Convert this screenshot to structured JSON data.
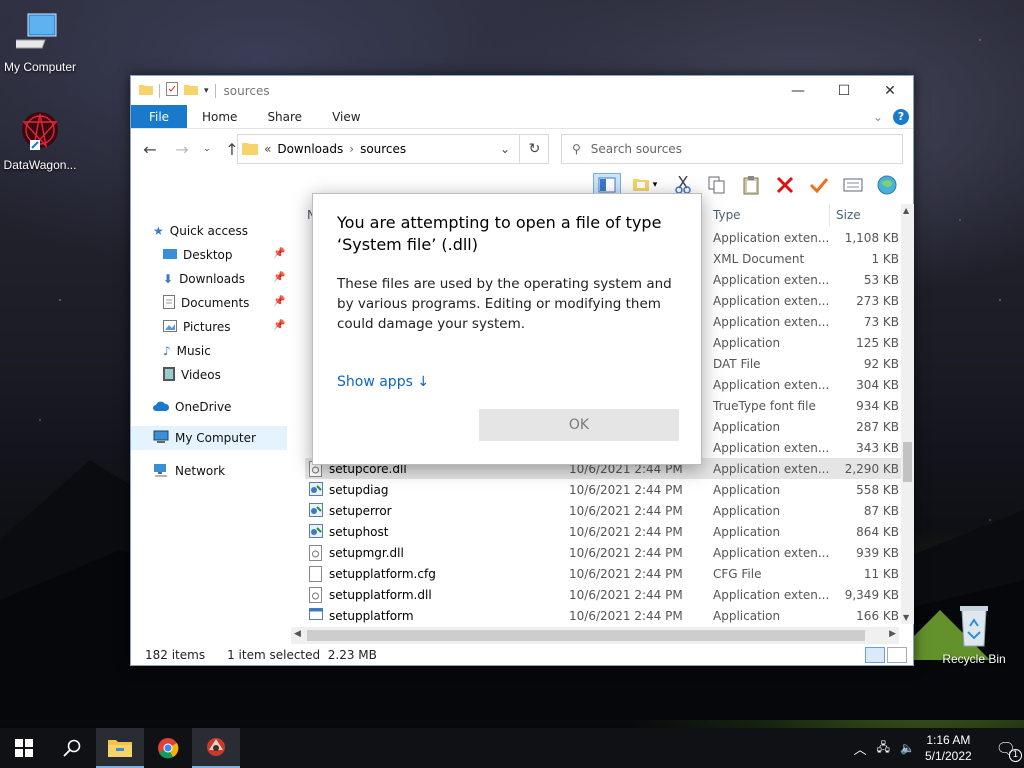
{
  "desktop": {
    "icons": [
      {
        "label": "My Computer"
      },
      {
        "label": "DataWagon..."
      },
      {
        "label": "Recycle Bin"
      }
    ]
  },
  "window": {
    "title": "sources",
    "tabs": [
      "File",
      "Home",
      "Share",
      "View"
    ],
    "help_label": "?",
    "address": {
      "prefix": "«",
      "crumbs": [
        "Downloads",
        "sources"
      ]
    },
    "search_placeholder": "Search sources",
    "nav": {
      "quick_access": "Quick access",
      "items": [
        "Desktop",
        "Downloads",
        "Documents",
        "Pictures",
        "Music",
        "Videos"
      ],
      "onedrive": "OneDrive",
      "my_computer": "My Computer",
      "network": "Network"
    },
    "columns": {
      "name": "N",
      "type": "Type",
      "size": "Size"
    },
    "rows_partial": [
      {
        "type": "Application exten...",
        "size": "1,108 KB"
      },
      {
        "type": "XML Document",
        "size": "1 KB"
      },
      {
        "type": "Application exten...",
        "size": "53 KB"
      },
      {
        "type": "Application exten...",
        "size": "273 KB"
      },
      {
        "type": "Application exten...",
        "size": "73 KB"
      },
      {
        "type": "Application",
        "size": "125 KB"
      },
      {
        "type": "DAT File",
        "size": "92 KB"
      },
      {
        "type": "Application exten...",
        "size": "304 KB"
      },
      {
        "type": "TrueType font file",
        "size": "934 KB"
      },
      {
        "type": "Application",
        "size": "287 KB"
      },
      {
        "type": "Application exten...",
        "size": "343 KB"
      }
    ],
    "rows": [
      {
        "name": "setupcore.dll",
        "date": "10/6/2021 2:44 PM",
        "type": "Application exten...",
        "size": "2,290 KB",
        "selected": true
      },
      {
        "name": "setupdiag",
        "date": "10/6/2021 2:44 PM",
        "type": "Application",
        "size": "558 KB"
      },
      {
        "name": "setuperror",
        "date": "10/6/2021 2:44 PM",
        "type": "Application",
        "size": "87 KB"
      },
      {
        "name": "setuphost",
        "date": "10/6/2021 2:44 PM",
        "type": "Application",
        "size": "864 KB"
      },
      {
        "name": "setupmgr.dll",
        "date": "10/6/2021 2:44 PM",
        "type": "Application exten...",
        "size": "939 KB"
      },
      {
        "name": "setupplatform.cfg",
        "date": "10/6/2021 2:44 PM",
        "type": "CFG File",
        "size": "11 KB"
      },
      {
        "name": "setupplatform.dll",
        "date": "10/6/2021 2:44 PM",
        "type": "Application exten...",
        "size": "9,349 KB"
      },
      {
        "name": "setupplatform",
        "date": "10/6/2021 2:44 PM",
        "type": "Application",
        "size": "166 KB"
      }
    ],
    "status": {
      "count": "182 items",
      "selection": "1 item selected  2.23 MB"
    }
  },
  "dialog": {
    "title": "You are attempting to open a file of type ‘System file’ (.dll)",
    "body": "These files are used by the operating system and by various programs. Editing or modifying them could damage your system.",
    "link": "Show apps ↓",
    "ok": "OK"
  },
  "taskbar": {
    "time": "1:16 AM",
    "date": "5/1/2022",
    "notifications": "1"
  },
  "colors": {
    "accent": "#1979ca",
    "link": "#1066c4",
    "taskbar": "#101114"
  }
}
